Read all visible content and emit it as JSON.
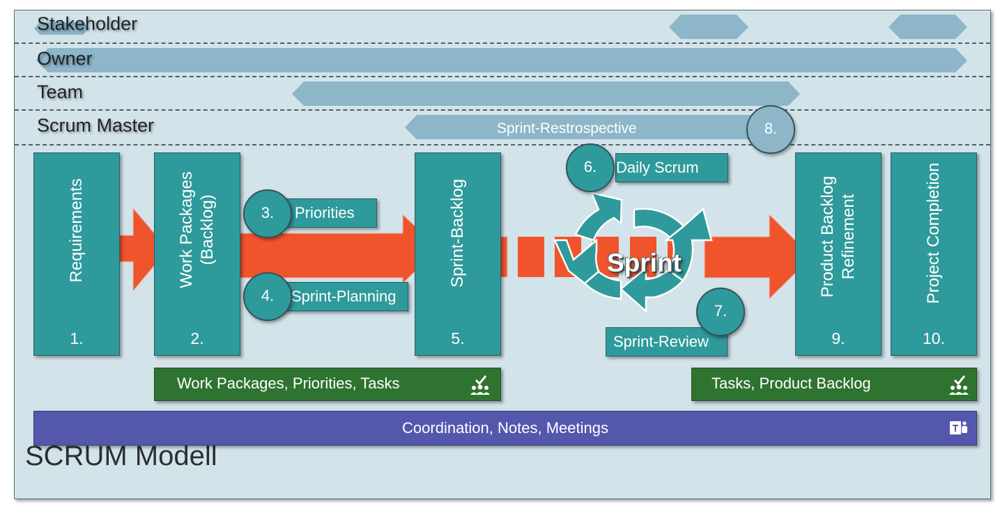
{
  "title": "SCRUM Modell",
  "lanes": [
    {
      "label": "Stakeholder"
    },
    {
      "label": "Owner"
    },
    {
      "label": "Team"
    },
    {
      "label": "Scrum Master"
    }
  ],
  "retrospective": {
    "label": "Sprint-Restrospective",
    "step": "8."
  },
  "steps": [
    {
      "label": "Requirements",
      "number": "1."
    },
    {
      "label_line1": "Work Packages",
      "label_line2": "(Backlog)",
      "number": "2."
    },
    {
      "label": "Sprint-Backlog",
      "number": "5."
    },
    {
      "label_line1": "Product Backlog",
      "label_line2": "Refinement",
      "number": "9."
    },
    {
      "label": "Project Completion",
      "number": "10."
    }
  ],
  "events": [
    {
      "step": "3.",
      "label": "Priorities"
    },
    {
      "step": "4.",
      "label": "Sprint-Planning"
    },
    {
      "step": "6.",
      "label": "Daily Scrum"
    },
    {
      "step": "7.",
      "label": "Sprint-Review"
    }
  ],
  "sprint": {
    "label": "Sprint"
  },
  "artifacts": [
    {
      "label": "Work Packages, Priorities, Tasks",
      "icon": "planner-team-check-icon"
    },
    {
      "label": "Tasks, Product Backlog",
      "icon": "planner-team-check-icon"
    }
  ],
  "communication": {
    "label": "Coordination, Notes, Meetings",
    "icon": "teams-icon"
  },
  "colors": {
    "background": "#d3e3ea",
    "lane_bar": "#8db6c8",
    "step_box": "#2f9a9c",
    "flow_arrow": "#f0542d",
    "artifact_bar": "#2e7330",
    "communication_bar": "#5358ad"
  }
}
